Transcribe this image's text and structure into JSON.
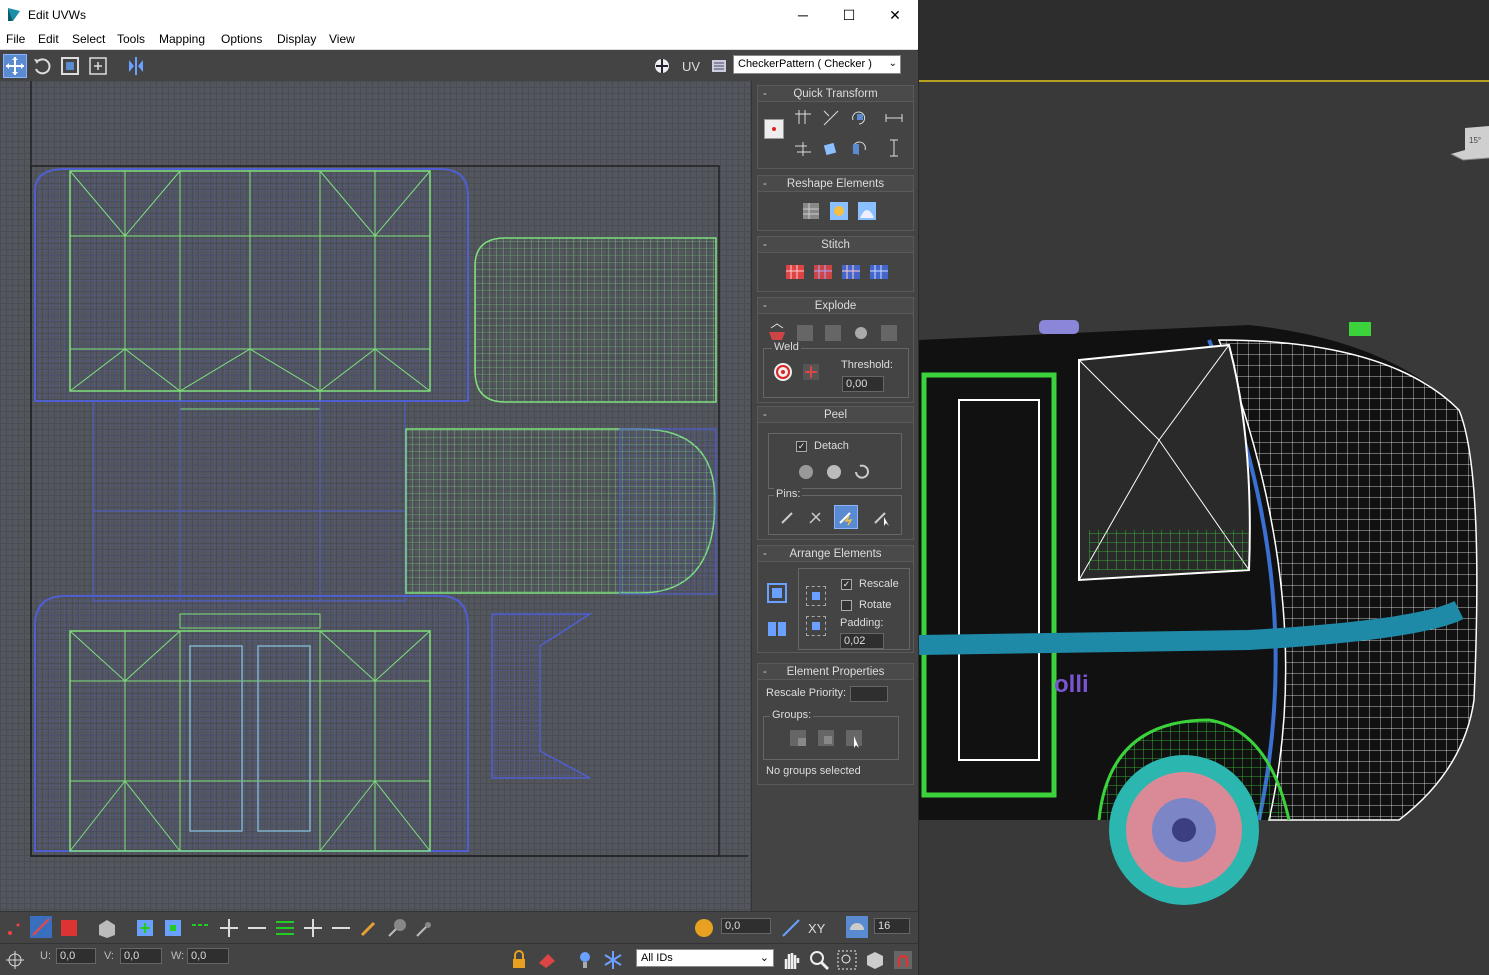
{
  "window": {
    "title": "Edit UVWs",
    "minimize_glyph": "─",
    "maximize_glyph": "☐",
    "close_glyph": "✕"
  },
  "menu": [
    "File",
    "Edit",
    "Select",
    "Tools",
    "Mapping",
    "Options",
    "Display",
    "View"
  ],
  "toolbar": {
    "uv_label": "UV",
    "texture_select": "CheckerPattern  ( Checker )"
  },
  "rollouts": {
    "quick_transform": {
      "title": "Quick Transform"
    },
    "reshape_elements": {
      "title": "Reshape Elements"
    },
    "stitch": {
      "title": "Stitch"
    },
    "explode": {
      "title": "Explode",
      "weld_label": "Weld",
      "threshold_label": "Threshold:",
      "threshold_value": "0,00"
    },
    "peel": {
      "title": "Peel",
      "detach_label": "Detach",
      "detach_checked": true,
      "pins_label": "Pins:"
    },
    "arrange_elements": {
      "title": "Arrange Elements",
      "rescale_label": "Rescale",
      "rescale_checked": true,
      "rotate_label": "Rotate",
      "rotate_checked": false,
      "padding_label": "Padding:",
      "padding_value": "0,02"
    },
    "element_properties": {
      "title": "Element Properties",
      "rescale_priority_label": "Rescale Priority:",
      "groups_label": "Groups:",
      "status": "No groups selected"
    }
  },
  "bottom_bar": {
    "soft_value": "0,0",
    "xy_label": "XY",
    "grid_value": "16",
    "u_label": "U:",
    "u_value": "0,0",
    "v_label": "V:",
    "v_value": "0,0",
    "w_label": "W:",
    "w_value": "0,0",
    "ids_select": "All IDs"
  },
  "colors": {
    "uv_green": "#7de07d",
    "uv_blue": "#4f5fd0",
    "selection_accent": "#5a8ad0",
    "viewport_border": "#b8a020"
  },
  "viewport": {
    "view_cube_label": "15°"
  }
}
